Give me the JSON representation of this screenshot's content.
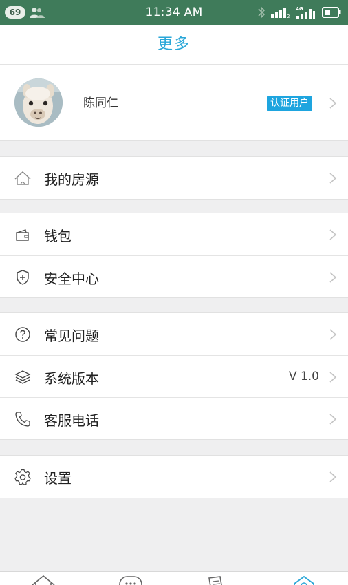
{
  "status_bar": {
    "notification_count": "69",
    "time": "11:34 AM",
    "network": "4G"
  },
  "header": {
    "title": "更多"
  },
  "profile": {
    "name": "陈同仁",
    "badge": "认证用户"
  },
  "menu": {
    "my_listings": "我的房源",
    "wallet": "钱包",
    "security_center": "安全中心",
    "faq": "常见问题",
    "system_version": "系统版本",
    "system_version_value": "V 1.0",
    "customer_service": "客服电话",
    "settings": "设置"
  },
  "colors": {
    "accent": "#2aa7d8",
    "status_bar": "#3f7b5a",
    "badge": "#1ea5df",
    "background": "#efeff0"
  },
  "icons": {
    "my_listings": "house-icon",
    "wallet": "wallet-icon",
    "security_center": "shield-icon",
    "faq": "question-icon",
    "system_version": "layers-icon",
    "customer_service": "phone-icon",
    "settings": "gear-icon"
  }
}
